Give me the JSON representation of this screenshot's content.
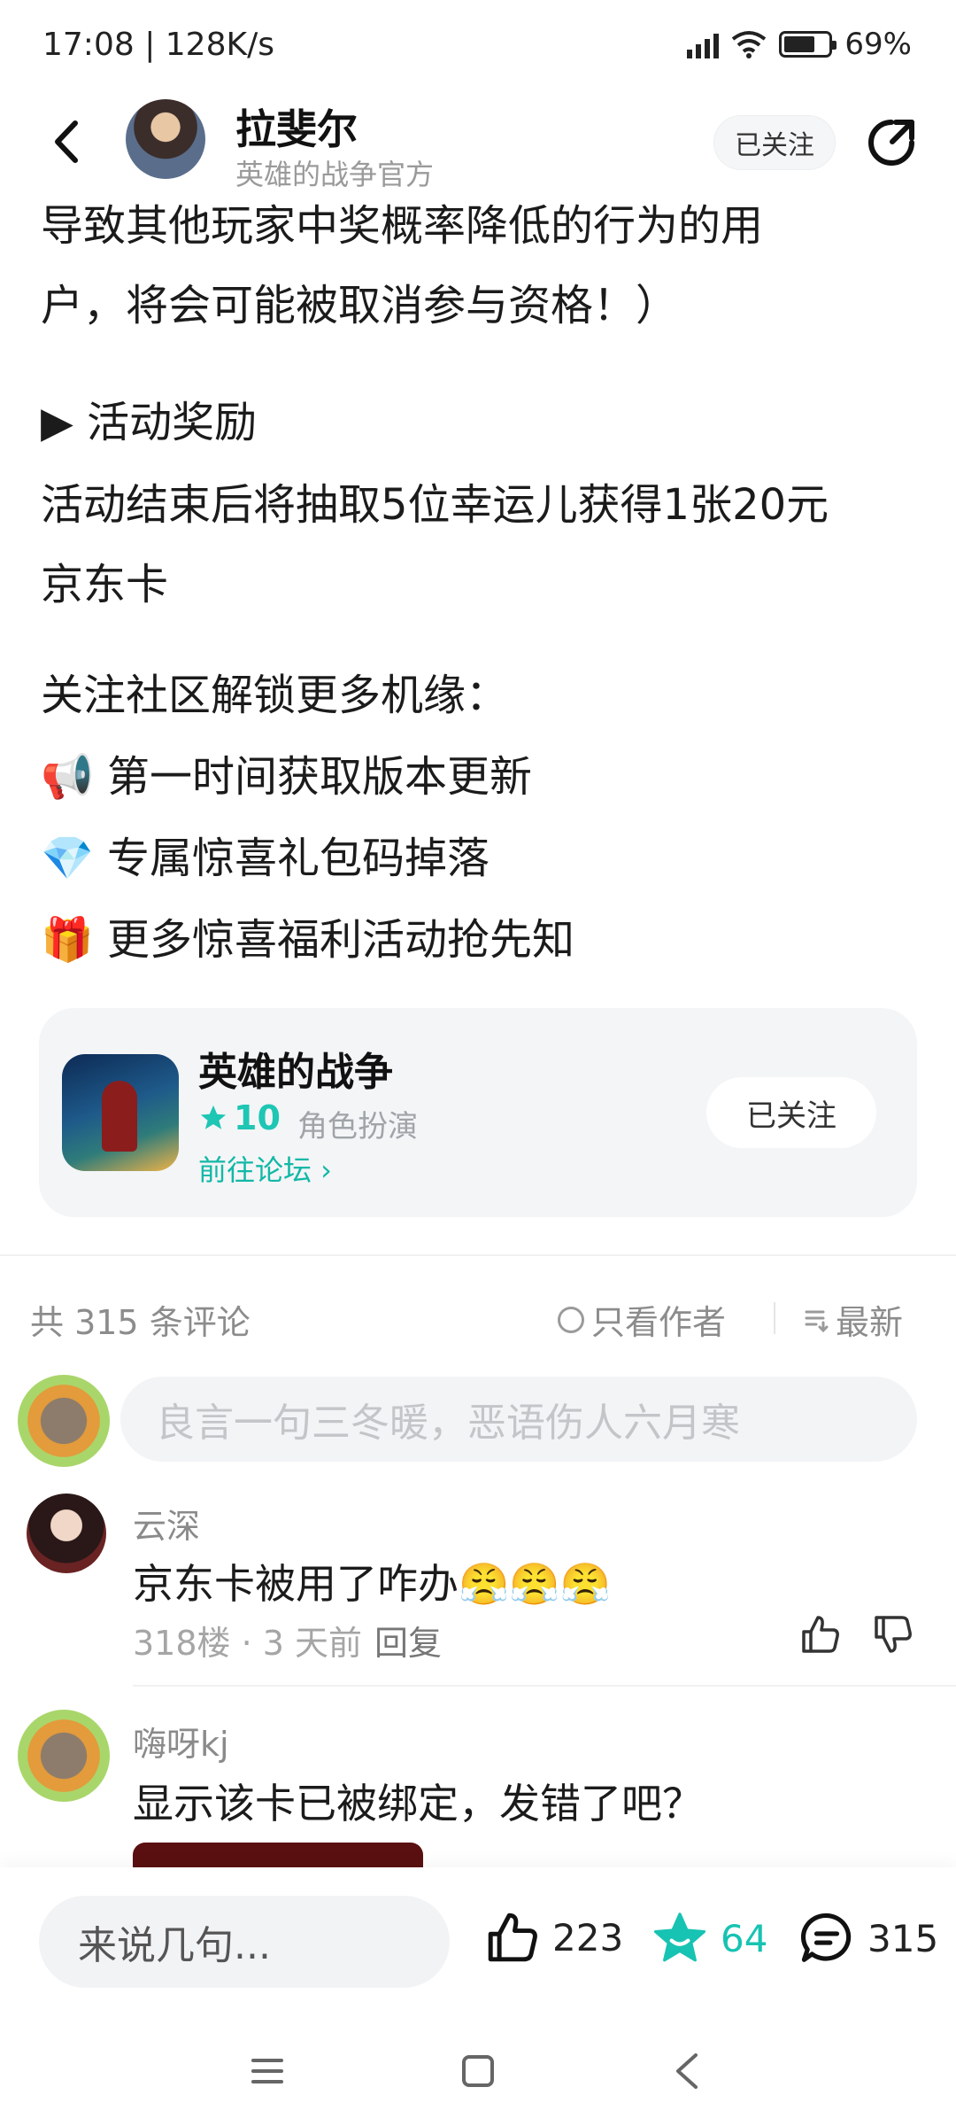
{
  "status_bar": {
    "time": "17:08 | 128K/s",
    "battery": "69%"
  },
  "header": {
    "author_name": "拉斐尔",
    "author_sub": "英雄的战争官方",
    "follow_label": "已关注"
  },
  "article": {
    "lines": [
      "导致其他玩家中奖概率降低的行为的用",
      "户，将会可能被取消参与资格！）",
      "▶ 活动奖励",
      "活动结束后将抽取5位幸运儿获得1张20元",
      "京东卡",
      "关注社区解锁更多机缘：",
      "📢 第一时间获取版本更新",
      "💎 专属惊喜礼包码掉落",
      "🎁 更多惊喜福利活动抢先知"
    ]
  },
  "forum_card": {
    "title": "英雄的战争",
    "rating": "10",
    "genre": "角色扮演",
    "goto_label": "前往论坛 ›",
    "follow_label": "已关注"
  },
  "comments_header": {
    "count_label": "共 315 条评论",
    "only_author_label": "只看作者",
    "sort_label": "最新"
  },
  "comment_input": {
    "placeholder": "良言一句三冬暖，恶语伤人六月寒"
  },
  "comments": [
    {
      "name": "云深",
      "text": "京东卡被用了咋办😤😤😤",
      "floor": "318楼 · 3 天前",
      "reply": "回复"
    },
    {
      "name": "嗨呀kj",
      "text": "显示该卡已被绑定，发错了吧？"
    }
  ],
  "bottom_bar": {
    "say_placeholder": "来说几句...",
    "likes": "223",
    "favorites": "64",
    "comments": "315",
    "accent_color": "#17c3b2"
  }
}
